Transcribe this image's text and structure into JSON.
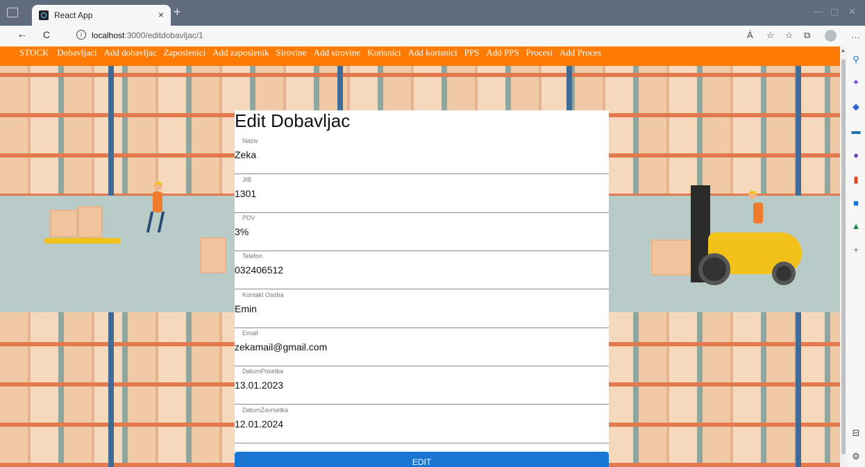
{
  "browser": {
    "tab_title": "React App",
    "tab_close": "×",
    "new_tab": "+",
    "url_host": "localhost",
    "url_path": ":3000/editdobavljac/1",
    "info": "i",
    "window_controls": [
      "—",
      "▢",
      "✕"
    ],
    "nav_icons": {
      "back": "←",
      "reload": "C"
    },
    "toolbar_icons": [
      "Á",
      "☆",
      "☆",
      "⧉",
      "…"
    ],
    "sidebar_icons": [
      "search-icon",
      "sparkle-icon",
      "tag-icon",
      "briefcase-icon",
      "people-icon",
      "office-icon",
      "outlook-icon",
      "tree-icon",
      "plus-icon",
      "panel-icon",
      "settings-icon"
    ]
  },
  "nav": {
    "items": [
      "STOCK",
      "Dobavljaci",
      "Add dobavljac",
      "Zaposlenici",
      "Add zaposlenik",
      "Sirovine",
      "Add sirovine",
      "Korisnici",
      "Add korisnici",
      "PPS",
      "Add PPS",
      "Procesi",
      "Add Proces"
    ]
  },
  "form": {
    "title": "Edit Dobavljac",
    "fields": [
      {
        "label": "Naziv",
        "value": "Zeka"
      },
      {
        "label": "JIB",
        "value": "1301"
      },
      {
        "label": "PDV",
        "value": "3%"
      },
      {
        "label": "Telefon",
        "value": "032406512"
      },
      {
        "label": "Kontakt Osoba",
        "value": "Emin"
      },
      {
        "label": "Email",
        "value": "zekamail@gmail.com"
      },
      {
        "label": "DatumPocetka",
        "value": "13.01.2023"
      },
      {
        "label": "DatumZavrsetka",
        "value": "12.01.2024"
      }
    ],
    "submit_label": "EDIT"
  },
  "colors": {
    "nav_bg": "#ff7a00",
    "button_bg": "#1976d2",
    "titlebar_bg": "#606b7d"
  }
}
